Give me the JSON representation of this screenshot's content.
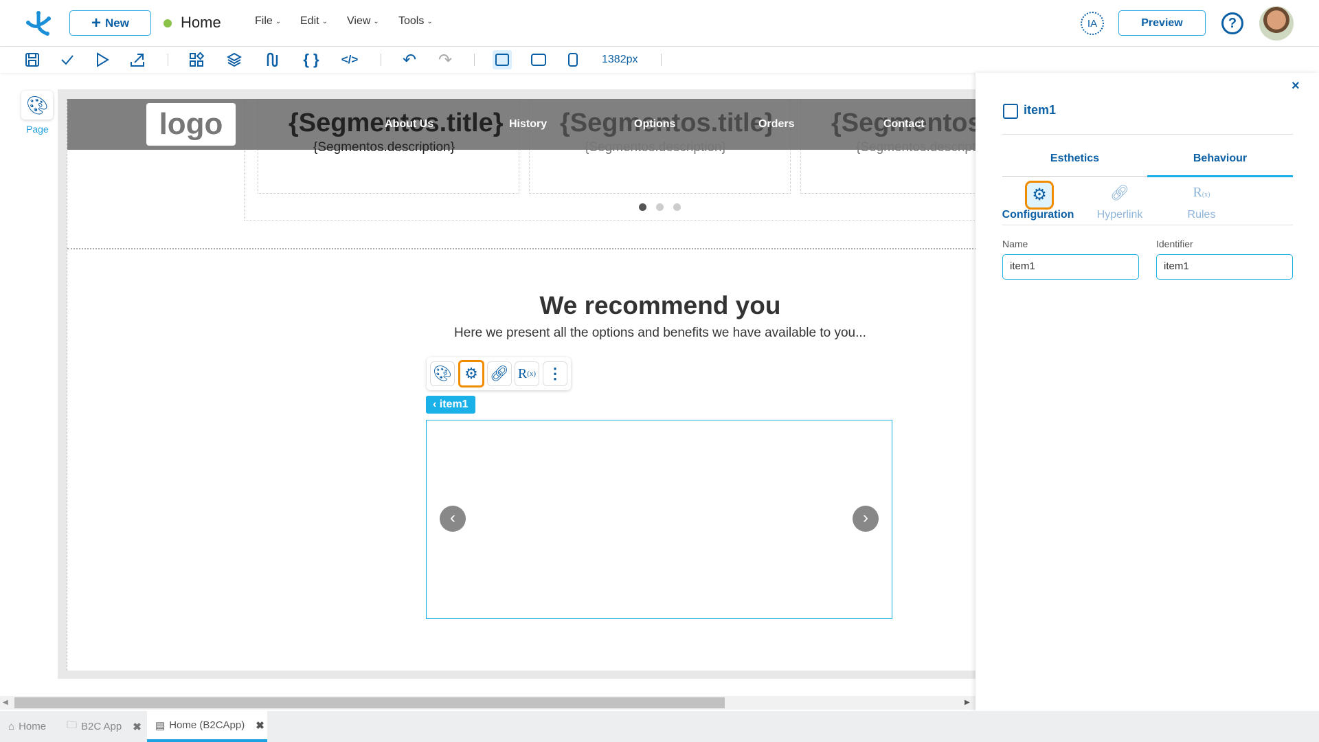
{
  "header": {
    "new_label": "New",
    "page_title": "Home",
    "status_color": "#8bc34a",
    "menus": [
      "File",
      "Edit",
      "View",
      "Tools"
    ],
    "ia_label": "IA",
    "preview_label": "Preview"
  },
  "toolbar": {
    "width_label": "1382px"
  },
  "sidebar": {
    "page_label": "Page"
  },
  "canvas": {
    "logo": "logo",
    "segment_title": "{Segmentos.title}",
    "segment_description": "{Segmentos.description}",
    "nav": [
      "About Us",
      "History",
      "Options",
      "Orders",
      "Contact"
    ],
    "heading": "We recommend you",
    "subheading": "Here we present all the options and benefits we have available to you...",
    "selected_label": "item1",
    "carousel_active_dot": 1,
    "carousel_dots": 3
  },
  "panel": {
    "item_name": "item1",
    "tabs": [
      "Esthetics",
      "Behaviour"
    ],
    "active_tab": "Behaviour",
    "subtabs": [
      "Configuration",
      "Hyperlink",
      "Rules"
    ],
    "active_subtab": "Configuration",
    "name_label": "Name",
    "name_value": "item1",
    "identifier_label": "Identifier",
    "identifier_value": "item1"
  },
  "bottom_tabs": [
    {
      "label": "Home"
    },
    {
      "label": "B2C App"
    },
    {
      "label": "Home (B2CApp)",
      "active": true
    }
  ],
  "colors": {
    "accent": "#0b5fa5",
    "highlight": "#f08c00",
    "selection": "#1ab0e8"
  }
}
